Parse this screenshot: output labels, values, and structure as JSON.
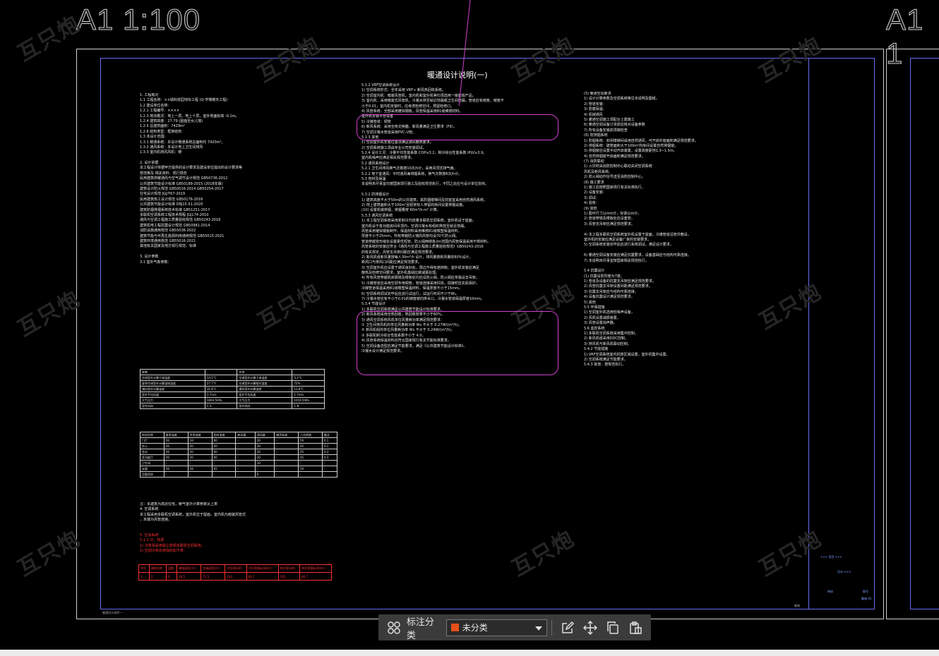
{
  "canvas": {
    "scale_label_left": "A1  1:100",
    "scale_label_right": "A1  1",
    "doc_title": "暖通设计说明(一)",
    "watermark": "互只炮"
  },
  "col1": {
    "lines": [
      "1. 工程概况",
      "1.1 工程名称：××城科技园地块工程 (Q-学楼暖天工程)",
      "1.2 建设单位名称：",
      "1.2.1 工程编号：××××",
      "1.2.3 地块概况：地上一层，地上十层，室外地面标高 -0.1m。",
      "1.2.4 建筑高度：27.79 (屋面至女儿墙)",
      "1.2.5 总建筑面积：7429m²",
      "1.2.6 结构类型：框架结构",
      "1.3 本设计范围：",
      "1.3.1 暖通系统：本设计暖通系统总面积约 7420m²。",
      "1.3.2 通风系统：本设计地上卫生间排风",
      "1.3.3 室内机排风风机：暖",
      "",
      "2. 设计依据",
      "   本工程设计依据甲方提供的设计要求及建设单位提出的设计要求等",
      "   规范等及 相关资料：现行规范",
      "   民用建筑供暖通风与空气调节设计规范 GB50736-2012",
      "   公共建筑节能设计标准 GB50189-2015 (2018年版)",
      "   建筑设计防火规范 GB50016-2014   GB50254-2017",
      "   住宅设计规范 JGJ/T67-2019",
      "   民用建筑热工设计规范 GB50176-2016",
      "   公共建筑节能设计标准 DBJ15-51-2020",
      "   建筑防烟排烟系统技术标准 GB51251-2017",
      "   多联机空调系统工程技术规程 JGJ174-2010",
      "   通风与空调工程施工质量验收规范 GB50243-2016",
      "   建筑机电工程抗震设计规范 GB50981-2014",
      "   消防设施通用规范 GB55036-2022",
      "   建筑节能与可再生能源利用通用规范 GB55015-2021",
      "   建筑环境通用规范 GB55016-2021",
      "   其他有关国家及地方现行规范、标准",
      "",
      "3. 设计参数",
      "3.1 室外气象参数："
    ]
  },
  "col1b": {
    "lines": [
      "注：本建筑为高层住宅，暖气室外计算参数见上表",
      "4. 空调系统",
      "   本工程采用多联机空调系统，室外机位于屋面，室内机为暗装风管式",
      "   ，末端为风管连接。"
    ]
  },
  "col1c": {
    "lines": [
      "5. 空调系统",
      "5.1.1 冷、热源",
      "1) 冷热源采用独立变频多联机空调系统，",
      "2) 空调冷热负荷指标如下表："
    ]
  },
  "col2": {
    "lines": [
      "5.1.2 VRF空调系统设计",
      "1) 空调系统形式：全年采用 VRF+ 新风热回收系统。",
      "2) 空调室内机：暗装风管机，室内机和室外机等均须选用一级能效产品。",
      "3) 室内机：采用暗装式风管机，冷凝水排至就近地漏或卫生间地漏，管道应有坡度，坡度不",
      "   小于0.01，室内机安装时，应考虑检修空间，预留检修口。",
      "4) 风管系统：全部采用镀锌钢板，风管保温采用B1级难燃材料。",
      "   室外机安装平台设置",
      "5) 冷媒管道：铜管",
      "6) 新风系统：采用全热交换器，新风量满足卫生要求（F6）。",
      "7) 空调冷凝水管道采用PVC-U管。",
      "5.1.3 其他",
      "1) 空调室外机安装位置须满足通风散热要求。",
      "2) 空调系统施工须由专业公司安装调试。",
      "5.1.4 设计工况：冷量平均性能系数 COP≥3.2，制冷综合性能系数 IPLV≥3.9。",
      "   室内机噪声应满足相关规范要求。",
      "5.2 通风系统设计",
      "5.2.1 卫生间排风换气次数按10次/h计，采用吊顶式排气扇。",
      "5.2.2 地下室通风：平时通风兼排烟系统，换气次数按6次/h计。",
      "5.3 管材及保温",
      "   本说明未尽事宜均按国家现行施工及验收规范执行，不同之处应与设计单位协商。",
      "",
      "5.3.2 防排烟设计",
      "1) 建筑高度不大于50m的公共建筑，其防烟楼梯间及前室宜采用自然通风系统。",
      "2) 地上建筑面积大于100m²且经常有人停留的房间设置排烟设施。",
      "   (10) 设置机械排烟，排烟量按 60m³/h·m² 计算。",
      "5.3.3 通风空调系统",
      "1) 本工程空调系统采用变制冷剂流量多联机空调系统，室外机设于屋面，",
      "   室内机设于各功能房间吊顶内，空调冷凝水有组织排放至就近地漏。",
      "   风管采用镀锌钢板制作，保温材料采用难燃B1级橡塑保温材料，",
      "   厚度不小于25mm，所有穿越防火墙的风管均设70℃防火阀。",
      "   管道穿越变形缝处设置柔性短管，防火阀两侧各2m范围内风管保温采用不燃材料。",
      "   风管系统的安装应符合《通风与空调工程施工质量验收规范》GB50243-2016",
      "   的有关规定，风管支吊架间距应满足规范要求。",
      "2) 新风机组新风量按每人30m³/h 设计，排风量按新风量的80%设计，",
      "   新风口与排风口间距应满足规范要求。",
      "3) 空调室外机应设置于通风良好处，周边不得有遮挡物，室外机安装应满足",
      "   散热及检修空间要求，室外机基础应做减振处理。",
      "4) 所有风管穿越机房隔墙及楼板处均应设防火阀，防火阀应单独设支吊架。",
      "5) 冷媒管道应采用空调专用铜管，管道连接采用钎焊，焊接时应充氮保护。",
      "   冷媒管道保温采用B1级橡塑保温材料，保温厚度不小于15mm。",
      "6) 空调系统调试完毕后应进行试运行，试运行时间不少于8h。",
      "7) 冷凝水管应有不小于0.01的坡度坡向排水口，冷凝水管道保温厚度10mm。",
      "5.3.4 节能设计",
      "1) 多联机空调系统满足公共建筑节能设计标准要求，",
      "2) 新风系统采用全热回收，热回收效率不小于60%。",
      "3) 通风空调系统风机单位风量耗功率满足规范要求：",
      "   ① 卫生间排风机的单位风量耗功率 Ws 不大于 0.27W/(m³/h)，",
      "   ② 新风机组的单位风量耗功率 Ws 不大于 0.24W/(m³/h)，",
      "   ③ 多联机制冷综合性能系数不小于 4.0。",
      "4) 风管系统保温材料应符合国家现行有关节能标准要求。",
      "5) 空调设备选型应满足节能要求，满足《公共建筑节能设计标准》。",
      "   冷凝水设计满足规范要求。"
    ]
  },
  "col3": {
    "lines": [
      "(5) 暖通空调要求",
      "1) 设计计算参数及空调系统等见本说明及图纸。",
      "2) 管道安装：",
      "3) 防腐保温：",
      "4) 机械通风",
      "5) 暖通空调施工须配合土建施工",
      "6) 暖通空调设备订货前应核对设备参数",
      "7) 所有设备安装前须做检查",
      "(6) 防排烟系统",
      "1) 防烟系统：封闭楼梯间采用自然通风，可开启外窗面积满足规范要求。",
      "2) 排烟系统：建筑面积大于100m²的房间设置自然排烟窗。",
      "3) 排烟窗应设置手动开启装置，设置高度距地1.3~1.5m。",
      "4) 自然排烟窗开启面积满足规范要求。",
      "(7) 消防联动",
      "1) 火灾时由消防控制中心联动关闭空调系统",
      "   风机及新风系统。",
      "2) 防火阀动作信号送至消防控制中心。",
      "(8) 施工要求",
      "1) 施工应按照国家现行有关标准执行。",
      "2) 设备安装：",
      "3) 调试：",
      "4) 验收：",
      "(9) 其他",
      "1) 图中尺寸以mm计，标高以m计。",
      "2) 管道穿墙及楼板处应设套管。",
      "3) 风管支吊架应满足规范要求。",
      "",
      "4) 本工程多联机空调系统室外机设置于屋面，冷媒管道沿管井敷设，",
      "   室外机的安装应满足设备厂家的安装要求，",
      "5) 空调系统安装完毕后应进行系统调试，满足设计要求。",
      "",
      "6) 暖通空调设备安装应满足抗震要求，设备基础应与结构可靠连接。",
      "7) 本说明未尽事宜按国家相关规范执行。",
      "",
      "5.4 抗震设计",
      "(1) 抗震设防烈度为7度。",
      "1) 管道及设备的抗震支吊架应满足规范要求。",
      "2) 风管抗震支吊架设置间距满足规范要求。",
      "3) 抗震支吊架应与结构可靠连接。",
      "4) 设备抗震设计满足规范要求。",
      "5) 其他",
      "5.5 环保措施",
      "1) 空调室外机选用低噪声设备，",
      "2) 风机设置减振装置，",
      "3) 风管设置消声器。",
      "5.6 监控系统",
      "1) 多联机空调系统采用集中控制，",
      "2) 新风机组采用DDC控制，",
      "3) 排风机与新风机联动控制。",
      "5.4.2 节能措施",
      "1) VRF空调系统室内机按区域设置，室外机集中设置。",
      "2) 空调系统满足节能要求。",
      "5.4.3 其他：按规范执行。"
    ]
  },
  "outdoor_table": {
    "header": [
      "参数",
      "",
      "冬季",
      ""
    ],
    "rows": [
      [
        "空调室外计算干球温度",
        "33.5°C",
        "空调室外计算干球温度",
        "5.2°C"
      ],
      [
        "夏季空调室外计算湿球温度",
        "27.7°C",
        "空调室外计算相对湿度",
        "72%"
      ],
      [
        "通风室外计算温度",
        "31.8°C",
        "通风室外计算温度",
        "13.6°C"
      ],
      [
        "室外平均风速",
        "1.7m/s",
        "室外平均风速",
        "1.7m/s"
      ],
      [
        "大气压力",
        "1004.5hPa",
        "大气压力",
        "1019.5hPa"
      ],
      [
        "室外风向",
        "C S",
        "室外风向",
        "C N"
      ]
    ]
  },
  "room_table": {
    "header": [
      "房间名称",
      "夏季温度",
      "冬季温度",
      "相对湿度",
      "新风量",
      "排风量",
      "噪声标准",
      "人员密度",
      "备注"
    ],
    "rows": [
      [
        "门厅",
        "26",
        "18",
        "60",
        "-",
        "30",
        "-",
        "50",
        "0.1"
      ],
      [
        "办公",
        "26",
        "20",
        "60",
        "-",
        "30",
        "-",
        "45",
        "0.1"
      ],
      [
        "会议",
        "26",
        "20",
        "60",
        "-",
        "30",
        "-",
        "45",
        "0.3"
      ],
      [
        "多功能厅",
        "26",
        "20",
        "60",
        "-",
        "30",
        "-",
        "45",
        "0.3"
      ],
      [
        "卫生间",
        "-",
        "-",
        "-",
        "-",
        "10",
        "-",
        "-",
        "-"
      ],
      [
        "走廊",
        "26",
        "18",
        "65",
        "-",
        "-",
        "-",
        "50",
        "-"
      ],
      [
        "设备用房",
        "-",
        "-",
        "-",
        "-",
        "6",
        "-",
        "-",
        "-"
      ]
    ]
  },
  "red_table": {
    "header": [
      "序号",
      "建筑名称",
      "层数",
      "建筑面积(m²)",
      "空调面积(m²)",
      "冷负荷(kW)",
      "冷负荷指标(W/m²)",
      "热负荷(kW)",
      "热负荷指标(W/m²)"
    ],
    "rows": [
      [
        "2",
        "2",
        "6",
        "28.5",
        "71.5",
        "143",
        "86.7",
        "103",
        "66.7"
      ]
    ]
  },
  "title_block": {
    "line1": "××× 项目 ×××",
    "line2": "设计 ×××",
    "line3": "审核",
    "line4": "图号",
    "sheet_no": "暖施-01",
    "footer_left": "暖通设计说明 一",
    "footer_right": "暖施"
  },
  "toolbar": {
    "category_label": "标注分类",
    "category_value": "未分类",
    "category_swatch_color": "#e8501a",
    "icons": [
      "grid-icon",
      "edit-note-icon",
      "move-icon",
      "copy-icon",
      "paste-icon"
    ]
  }
}
